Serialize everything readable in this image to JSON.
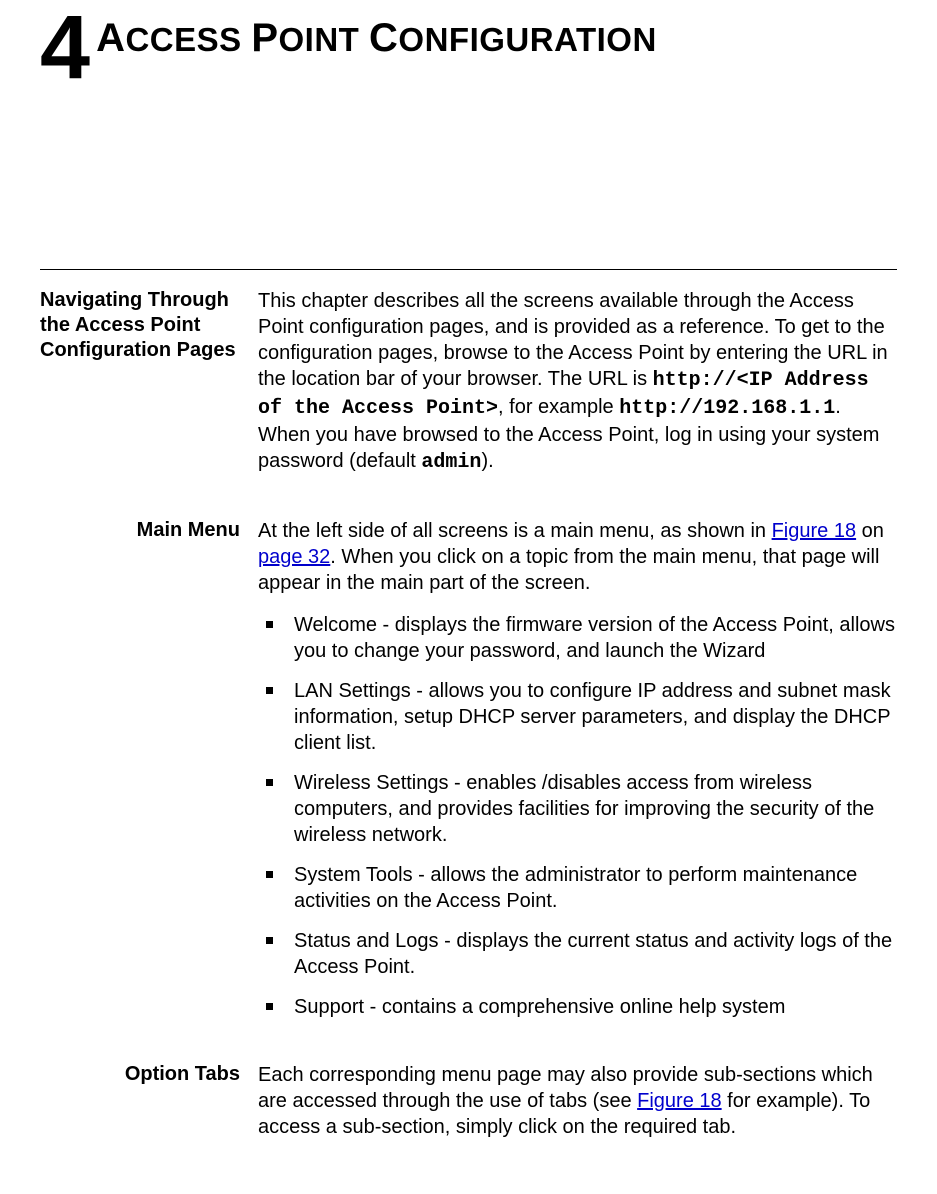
{
  "chapter": {
    "number": "4",
    "title_pre": "A",
    "title_rest": "CCESS",
    "title_word2_pre": "P",
    "title_word2_rest": "OINT",
    "title_word3_pre": "C",
    "title_word3_rest": "ONFIGURATION"
  },
  "sections": {
    "navigating": {
      "heading": "Navigating Through the Access Point Configuration Pages",
      "p1_a": "This chapter describes all the screens available through the Access Point configuration pages, and is provided as a reference. To get to the configuration pages, browse to the Access Point by entering the URL in the location bar of your browser. The URL is ",
      "code1": "http://<IP Address of the Access Point>",
      "p1_b": ", for example ",
      "code2": "http://192.168.1.1",
      "p1_c": ". When you have browsed to the Access Point, log in using your system password (default ",
      "code3": "admin",
      "p1_d": ")."
    },
    "main_menu": {
      "heading": "Main Menu",
      "p1_a": "At the left side of all screens is a main menu, as shown in ",
      "link1": "Figure 18",
      "p1_b": " on ",
      "link2": "page 32",
      "p1_c": ". When you click on a topic from the main menu, that page will appear in the main part of the screen.",
      "items": [
        "Welcome - displays the firmware version of the Access Point, allows you to change your password, and launch the Wizard",
        "LAN Settings - allows you to configure IP address and subnet mask information, setup DHCP server parameters, and display the DHCP client list.",
        "Wireless Settings - enables /disables access from wireless computers, and provides facilities for improving the security of the wireless network.",
        "System Tools - allows the administrator to perform maintenance activities on the Access Point.",
        "Status and Logs - displays the current status and activity logs of the Access Point.",
        "Support - contains a comprehensive online help system"
      ]
    },
    "option_tabs": {
      "heading": "Option Tabs",
      "p1_a": "Each corresponding menu page may also provide sub-sections which are accessed through the use of tabs (see ",
      "link1": "Figure 18",
      "p1_b": " for example). To access a sub-section, simply click on the required tab."
    }
  }
}
